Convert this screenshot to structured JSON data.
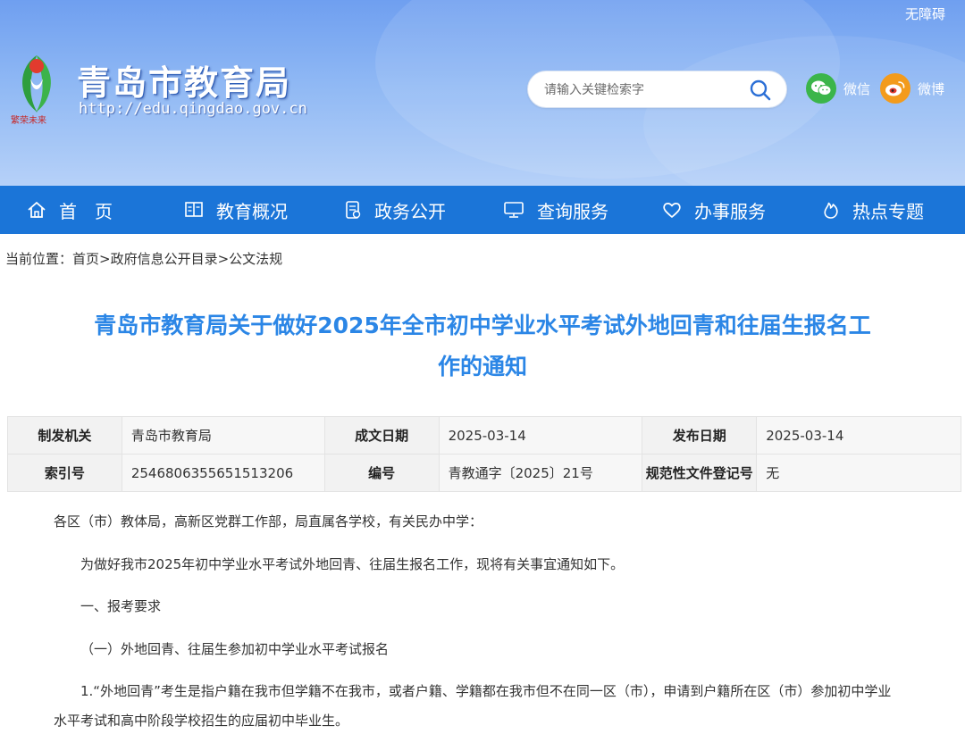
{
  "header": {
    "accessibility_label": "无障碍",
    "site_name": "青岛市教育局",
    "site_url": "http://edu.qingdao.gov.cn",
    "emblem_text": "繁荣未来",
    "search_placeholder": "请输入关键检索字",
    "social": [
      {
        "label": "微信",
        "icon": "wechat-icon",
        "color": "#3bb54a"
      },
      {
        "label": "微博",
        "icon": "weibo-icon",
        "color": "#f39b1c"
      }
    ]
  },
  "nav": {
    "items": [
      {
        "label": "首　页",
        "icon": "home-icon"
      },
      {
        "label": "教育概况",
        "icon": "book-icon"
      },
      {
        "label": "政务公开",
        "icon": "document-icon"
      },
      {
        "label": "查询服务",
        "icon": "monitor-icon"
      },
      {
        "label": "办事服务",
        "icon": "heart-icon"
      },
      {
        "label": "热点专题",
        "icon": "flame-icon"
      }
    ]
  },
  "breadcrumb": {
    "text": "当前位置：首页>政府信息公开目录>公文法规"
  },
  "article": {
    "title_line1": "青岛市教育局关于做好2025年全市初中学业水平考试外地回青和往届生报名工",
    "title_line2": "作的通知",
    "meta": [
      [
        {
          "key": "制发机关",
          "value": "青岛市教育局"
        },
        {
          "key": "成文日期",
          "value": "2025-03-14"
        },
        {
          "key": "发布日期",
          "value": "2025-03-14"
        }
      ],
      [
        {
          "key": "索引号",
          "value": "2546806355651513206"
        },
        {
          "key": "编号",
          "value": "青教通字〔2025〕21号"
        },
        {
          "key": "规范性文件登记号",
          "value": "无"
        }
      ]
    ],
    "paragraphs": [
      "各区（市）教体局，高新区党群工作部，局直属各学校，有关民办中学：",
      "为做好我市2025年初中学业水平考试外地回青、往届生报名工作，现将有关事宜通知如下。",
      "一、报考要求",
      "（一）外地回青、往届生参加初中学业水平考试报名",
      "1.“外地回青”考生是指户籍在我市但学籍不在我市，或者户籍、学籍都在我市但不在同一区（市），申请到户籍所在区（市）参加初中学业",
      "水平考试和高中阶段学校招生的应届初中毕业生。"
    ]
  },
  "colors": {
    "nav_bg": "#1b75d8",
    "title": "#2b86e6",
    "header_top": "#6f9ff0"
  }
}
